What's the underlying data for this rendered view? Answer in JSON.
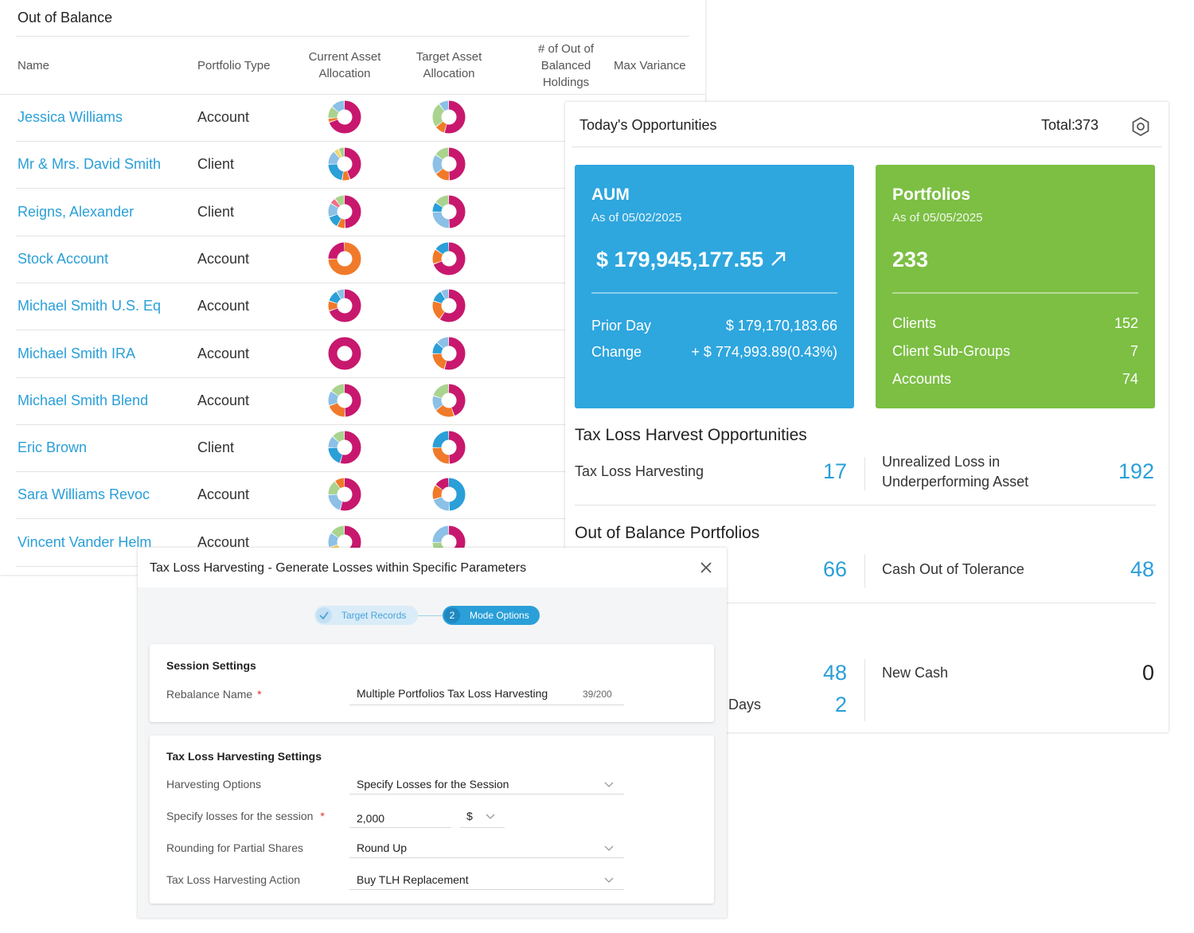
{
  "out_of_balance": {
    "title": "Out of Balance",
    "columns": {
      "name": "Name",
      "portfolio_type": "Portfolio Type",
      "current_asset": "Current Asset Allocation",
      "target_asset": "Target Asset Allocation",
      "num_oob": "# of Out of Balanced Holdings",
      "max_variance": "Max Variance"
    },
    "rows": [
      {
        "name": "Jessica Williams",
        "type": "Account",
        "current": [
          [
            "#c8186e",
            70
          ],
          [
            "#f07a2a",
            4
          ],
          [
            "#a9d38e",
            12
          ],
          [
            "#8cc0e6",
            14
          ]
        ],
        "target": [
          [
            "#c8186e",
            55
          ],
          [
            "#f07a2a",
            10
          ],
          [
            "#a9d38e",
            25
          ],
          [
            "#8cc0e6",
            10
          ]
        ]
      },
      {
        "name": "Mr & Mrs. David Smith",
        "type": "Client",
        "current": [
          [
            "#c8186e",
            45
          ],
          [
            "#f07a2a",
            8
          ],
          [
            "#2a9fd8",
            22
          ],
          [
            "#8cc0e6",
            14
          ],
          [
            "#f0d46a",
            5
          ],
          [
            "#a9d38e",
            6
          ]
        ],
        "target": [
          [
            "#c8186e",
            50
          ],
          [
            "#f07a2a",
            15
          ],
          [
            "#8cc0e6",
            20
          ],
          [
            "#a9d38e",
            15
          ]
        ]
      },
      {
        "name": "Reigns, Alexander",
        "type": "Client",
        "current": [
          [
            "#c8186e",
            50
          ],
          [
            "#f07a2a",
            8
          ],
          [
            "#2a9fd8",
            12
          ],
          [
            "#8cc0e6",
            14
          ],
          [
            "#f06f8a",
            6
          ],
          [
            "#a9d38e",
            10
          ]
        ],
        "target": [
          [
            "#c8186e",
            50
          ],
          [
            "#8cc0e6",
            25
          ],
          [
            "#2a9fd8",
            10
          ],
          [
            "#a9d38e",
            15
          ]
        ]
      },
      {
        "name": "Stock Account",
        "type": "Account",
        "current": [
          [
            "#f07a2a",
            75
          ],
          [
            "#c8186e",
            25
          ]
        ],
        "target": [
          [
            "#c8186e",
            70
          ],
          [
            "#f07a2a",
            15
          ],
          [
            "#2a9fd8",
            15
          ]
        ]
      },
      {
        "name": "Michael Smith U.S. Eq",
        "type": "Account",
        "current": [
          [
            "#c8186e",
            70
          ],
          [
            "#f07a2a",
            10
          ],
          [
            "#2a9fd8",
            12
          ],
          [
            "#8cc0e6",
            8
          ]
        ],
        "target": [
          [
            "#c8186e",
            60
          ],
          [
            "#f07a2a",
            20
          ],
          [
            "#2a9fd8",
            12
          ],
          [
            "#8cc0e6",
            8
          ]
        ]
      },
      {
        "name": "Michael Smith IRA",
        "type": "Account",
        "current": [
          [
            "#c8186e",
            100
          ]
        ],
        "target": [
          [
            "#c8186e",
            55
          ],
          [
            "#f07a2a",
            20
          ],
          [
            "#2a9fd8",
            12
          ],
          [
            "#8cc0e6",
            13
          ]
        ]
      },
      {
        "name": "Michael Smith Blend",
        "type": "Account",
        "current": [
          [
            "#c8186e",
            50
          ],
          [
            "#f07a2a",
            20
          ],
          [
            "#8cc0e6",
            15
          ],
          [
            "#a9d38e",
            15
          ]
        ],
        "target": [
          [
            "#c8186e",
            45
          ],
          [
            "#f07a2a",
            20
          ],
          [
            "#8cc0e6",
            15
          ],
          [
            "#a9d38e",
            20
          ]
        ]
      },
      {
        "name": "Eric Brown",
        "type": "Client",
        "current": [
          [
            "#c8186e",
            55
          ],
          [
            "#2a9fd8",
            20
          ],
          [
            "#8cc0e6",
            12
          ],
          [
            "#a9d38e",
            13
          ]
        ],
        "target": [
          [
            "#c8186e",
            50
          ],
          [
            "#f07a2a",
            25
          ],
          [
            "#2a9fd8",
            25
          ]
        ]
      },
      {
        "name": "Sara Williams Revoc",
        "type": "Account",
        "current": [
          [
            "#c8186e",
            55
          ],
          [
            "#8cc0e6",
            20
          ],
          [
            "#a9d38e",
            15
          ],
          [
            "#f07a2a",
            10
          ]
        ],
        "target": [
          [
            "#2a9fd8",
            50
          ],
          [
            "#8cc0e6",
            20
          ],
          [
            "#f07a2a",
            15
          ],
          [
            "#c8186e",
            15
          ]
        ]
      },
      {
        "name": "Vincent Vander Helm",
        "type": "Account",
        "current": [
          [
            "#c8186e",
            50
          ],
          [
            "#f0d46a",
            20
          ],
          [
            "#8cc0e6",
            15
          ],
          [
            "#a9d38e",
            15
          ]
        ],
        "target": [
          [
            "#c8186e",
            50
          ],
          [
            "#a9d38e",
            25
          ],
          [
            "#8cc0e6",
            25
          ]
        ]
      }
    ]
  },
  "opportunities": {
    "title": "Today's Opportunities",
    "total_label": "Total:",
    "total_value": "373",
    "aum": {
      "title": "AUM",
      "as_of": "As of 05/02/2025",
      "value": "$ 179,945,177.55",
      "trend": "arrow-up-right-icon",
      "prior_day_label": "Prior Day",
      "prior_day_value": "$ 179,170,183.66",
      "change_label": "Change",
      "change_value": "+ $ 774,993.89(0.43%)",
      "color": "#2ea6de"
    },
    "portfolios": {
      "title": "Portfolios",
      "as_of": "As of 05/05/2025",
      "value": "233",
      "clients_label": "Clients",
      "clients_value": "152",
      "subgroups_label": "Client Sub-Groups",
      "subgroups_value": "7",
      "accounts_label": "Accounts",
      "accounts_value": "74",
      "color": "#7cbf43"
    },
    "tlh_section": {
      "title": "Tax Loss Harvest Opportunities",
      "tlh_label": "Tax Loss Harvesting",
      "tlh_value": "17",
      "unreal_label_1": "Unrealized Loss in",
      "unreal_label_2": "Underperforming Asset",
      "unreal_value": "192"
    },
    "oob_section": {
      "title": "Out of Balance Portfolios",
      "first_value": "66",
      "cash_label": "Cash Out of Tolerance",
      "cash_value": "48"
    },
    "bottom": {
      "value_a": "48",
      "days_label": "Days",
      "days_value": "2",
      "new_cash_label": "New Cash",
      "new_cash_value": "0"
    }
  },
  "dialog": {
    "title": "Tax Loss Harvesting - Generate Losses within Specific Parameters",
    "steps": {
      "step1": "Target Records",
      "step2_num": "2",
      "step2": "Mode Options"
    },
    "session": {
      "title": "Session Settings",
      "rebalance_label": "Rebalance Name",
      "required_mark": "*",
      "rebalance_value": "Multiple Portfolios Tax Loss Harvesting",
      "counter": "39/200"
    },
    "tlh_settings": {
      "title": "Tax Loss Harvesting Settings",
      "harvesting_label": "Harvesting Options",
      "harvesting_value": "Specify Losses for the Session",
      "losses_label": "Specify losses for the session",
      "required_mark": "*",
      "losses_value": "2,000",
      "currency_value": "$",
      "rounding_label": "Rounding for Partial Shares",
      "rounding_value": "Round Up",
      "action_label": "Tax Loss Harvesting Action",
      "action_value": "Buy TLH Replacement"
    }
  }
}
